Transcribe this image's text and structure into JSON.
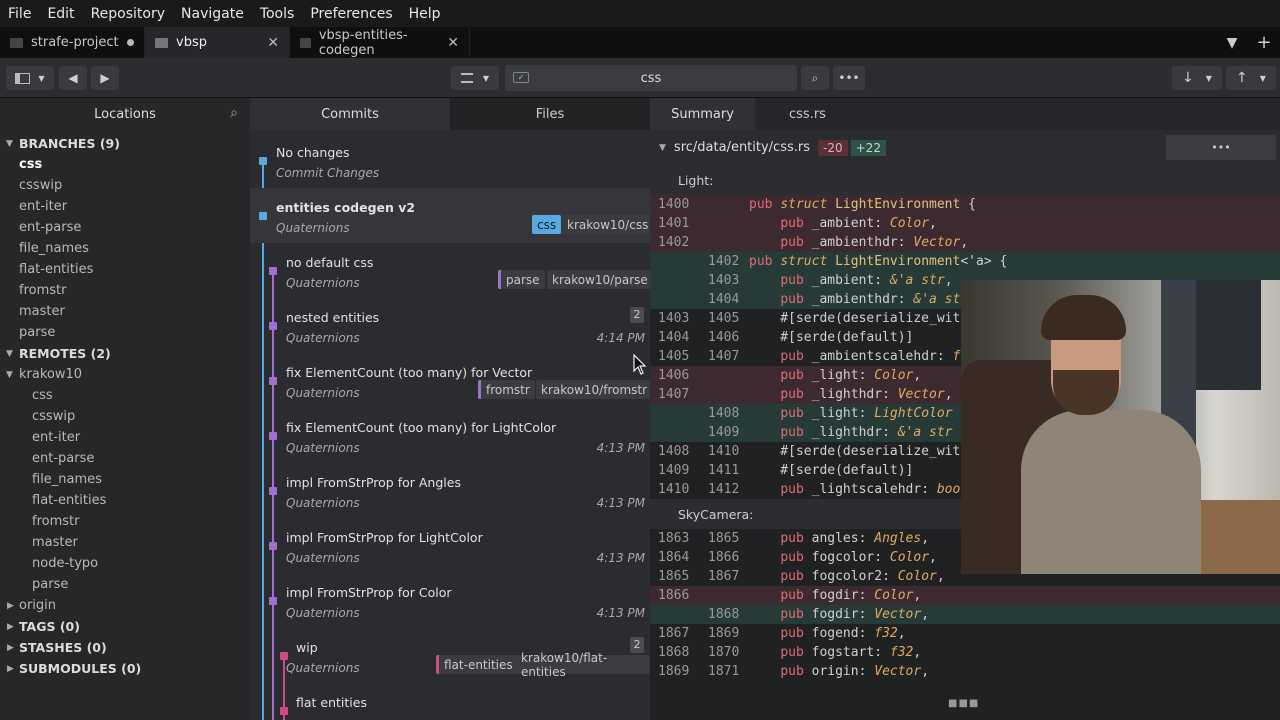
{
  "menu": [
    "File",
    "Edit",
    "Repository",
    "Navigate",
    "Tools",
    "Preferences",
    "Help"
  ],
  "tabs": [
    {
      "label": "strafe-project",
      "state": "modified"
    },
    {
      "label": "vbsp",
      "state": "active"
    },
    {
      "label": "vbsp-entities-codegen",
      "state": "closable"
    }
  ],
  "search": {
    "value": "css"
  },
  "sidebar": {
    "title": "Locations",
    "branches_header": "BRANCHES (9)",
    "branches": [
      "css",
      "csswip",
      "ent-iter",
      "ent-parse",
      "file_names",
      "flat-entities",
      "fromstr",
      "master",
      "parse"
    ],
    "remotes_header": "REMOTES (2)",
    "remote_name": "krakow10",
    "remote_branches": [
      "css",
      "csswip",
      "ent-iter",
      "ent-parse",
      "file_names",
      "flat-entities",
      "fromstr",
      "master",
      "node-typo",
      "parse"
    ],
    "origin": "origin",
    "tags": "TAGS (0)",
    "stashes": "STASHES (0)",
    "submodules": "SUBMODULES (0)"
  },
  "commits_tabs": [
    "Commits",
    "Files"
  ],
  "commits": [
    {
      "title": "No changes",
      "author": "Commit Changes",
      "time": ""
    },
    {
      "title": "entities codegen v2",
      "author": "Quaternions",
      "time": "",
      "badges": [
        "css",
        "krakow10/css"
      ]
    },
    {
      "title": "no default css",
      "author": "Quaternions",
      "time": "",
      "badges": [
        "parse",
        "krakow10/parse"
      ]
    },
    {
      "title": "nested entities",
      "author": "Quaternions",
      "time": "4:14 PM",
      "count": "2"
    },
    {
      "title": "fix ElementCount (too many) for Vector",
      "author": "Quaternions",
      "time": "",
      "badges": [
        "fromstr",
        "krakow10/fromstr"
      ]
    },
    {
      "title": "fix ElementCount (too many) for LightColor",
      "author": "Quaternions",
      "time": "4:13 PM"
    },
    {
      "title": "impl FromStrProp for Angles",
      "author": "Quaternions",
      "time": "4:13 PM"
    },
    {
      "title": "impl FromStrProp for LightColor",
      "author": "Quaternions",
      "time": "4:13 PM"
    },
    {
      "title": "impl FromStrProp for Color",
      "author": "Quaternions",
      "time": "4:13 PM"
    },
    {
      "title": "wip",
      "author": "Quaternions",
      "time": "",
      "count": "2",
      "badges": [
        "flat-entities",
        "krakow10/flat-entities"
      ]
    },
    {
      "title": "flat entities",
      "author": "",
      "time": ""
    }
  ],
  "diff": {
    "tabs": [
      "Summary",
      "css.rs"
    ],
    "file": "src/data/entity/css.rs",
    "removed": "-20",
    "added": "+22",
    "section1": "Light:",
    "section2": "SkyCamera:",
    "lines1": [
      {
        "a": "1400",
        "b": "",
        "t": "del",
        "code": "pub struct LightEnvironment {"
      },
      {
        "a": "1401",
        "b": "",
        "t": "del",
        "code": "    pub _ambient: Color,"
      },
      {
        "a": "1402",
        "b": "",
        "t": "del",
        "code": "    pub _ambienthdr: Vector,"
      },
      {
        "a": "",
        "b": "1402",
        "t": "add",
        "code": "pub struct LightEnvironment<'a> {"
      },
      {
        "a": "",
        "b": "1403",
        "t": "add",
        "code": "    pub _ambient: &'a str,"
      },
      {
        "a": "",
        "b": "1404",
        "t": "add",
        "code": "    pub _ambienthdr: &'a str,"
      },
      {
        "a": "1403",
        "b": "1405",
        "t": "",
        "code": "    #[serde(deserialize_with"
      },
      {
        "a": "1404",
        "b": "1406",
        "t": "",
        "code": "    #[serde(default)]"
      },
      {
        "a": "1405",
        "b": "1407",
        "t": "",
        "code": "    pub _ambientscalehdr: f"
      },
      {
        "a": "1406",
        "b": "",
        "t": "del",
        "code": "    pub _light: Color,"
      },
      {
        "a": "1407",
        "b": "",
        "t": "del",
        "code": "    pub _lighthdr: Vector,"
      },
      {
        "a": "",
        "b": "1408",
        "t": "add",
        "code": "    pub _light: LightColor"
      },
      {
        "a": "",
        "b": "1409",
        "t": "add",
        "code": "    pub _lighthdr: &'a str"
      },
      {
        "a": "1408",
        "b": "1410",
        "t": "",
        "code": "    #[serde(deserialize_wit"
      },
      {
        "a": "1409",
        "b": "1411",
        "t": "",
        "code": "    #[serde(default)]"
      },
      {
        "a": "1410",
        "b": "1412",
        "t": "",
        "code": "    pub _lightscalehdr: boo"
      }
    ],
    "lines2": [
      {
        "a": "1863",
        "b": "1865",
        "t": "",
        "code": "    pub angles: Angles,"
      },
      {
        "a": "1864",
        "b": "1866",
        "t": "",
        "code": "    pub fogcolor: Color,"
      },
      {
        "a": "1865",
        "b": "1867",
        "t": "",
        "code": "    pub fogcolor2: Color,"
      },
      {
        "a": "1866",
        "b": "",
        "t": "del",
        "code": "    pub fogdir: Color,"
      },
      {
        "a": "",
        "b": "1868",
        "t": "add",
        "code": "    pub fogdir: Vector,"
      },
      {
        "a": "1867",
        "b": "1869",
        "t": "",
        "code": "    pub fogend: f32,"
      },
      {
        "a": "1868",
        "b": "1870",
        "t": "",
        "code": "    pub fogstart: f32,"
      },
      {
        "a": "1869",
        "b": "1871",
        "t": "",
        "code": "    pub origin: Vector,"
      }
    ]
  },
  "colors": {
    "accent": "#5aa8e0",
    "branch_purple": "#a070d0",
    "branch_pink": "#d04a8a",
    "del_bg": "#3d2a30",
    "add_bg": "#263a38"
  }
}
